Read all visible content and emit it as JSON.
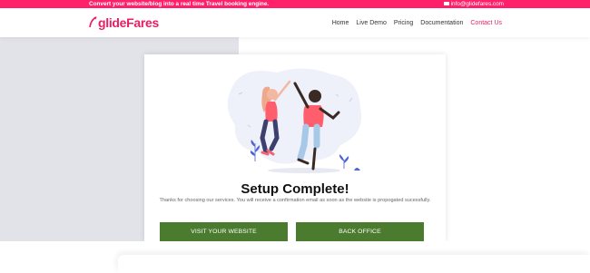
{
  "topbar": {
    "tagline": "Convert your website/blog into a real time Travel booking engine.",
    "email": "info@glidefares.com"
  },
  "navbar": {
    "logo_text": "glideFares",
    "items": [
      {
        "label": "Home"
      },
      {
        "label": "Live Demo"
      },
      {
        "label": "Pricing"
      },
      {
        "label": "Documentation"
      },
      {
        "label": "Contact Us",
        "active": true
      }
    ]
  },
  "card": {
    "title": "Setup Complete!",
    "message": "Thanks for choosing our services. You will receive a confirmation email as soon as the website is propogated sucessfully.",
    "buttons": {
      "visit": "VISIT YOUR WEBSITE",
      "back_office": "BACK OFFICE"
    }
  },
  "colors": {
    "brand_pink": "#ff1f6b",
    "button_green": "#4b7b2f",
    "gray_panel": "#e2e3e8"
  },
  "icons": {
    "email": "envelope-icon",
    "logo": "airplane-swoosh-icon",
    "illustration": "high-five-illustration"
  }
}
